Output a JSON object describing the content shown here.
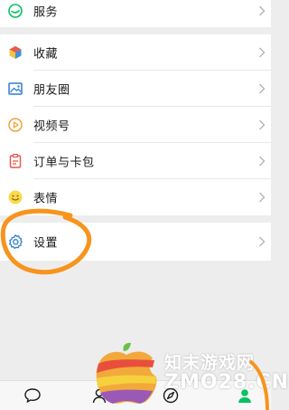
{
  "menu": {
    "services": {
      "label": "服务",
      "icon": "service-icon"
    },
    "group2": [
      {
        "label": "收藏",
        "icon": "favorites-cube-icon"
      },
      {
        "label": "朋友圈",
        "icon": "moments-photo-icon"
      },
      {
        "label": "视频号",
        "icon": "channels-play-icon"
      },
      {
        "label": "订单与卡包",
        "icon": "orders-cards-icon"
      },
      {
        "label": "表情",
        "icon": "stickers-smiley-icon"
      }
    ],
    "settings": {
      "label": "设置",
      "icon": "gear-icon"
    }
  },
  "tabbar": [
    {
      "icon": "chats-icon"
    },
    {
      "icon": "contacts-icon"
    },
    {
      "icon": "discover-compass-icon"
    },
    {
      "icon": "me-icon",
      "active": true
    }
  ],
  "watermark": {
    "text": "知末游戏网",
    "domain": "ZMO28.CN"
  },
  "colors": {
    "accent": "#07C160",
    "annotation": "#F7941D",
    "background": "#EDEDED"
  }
}
